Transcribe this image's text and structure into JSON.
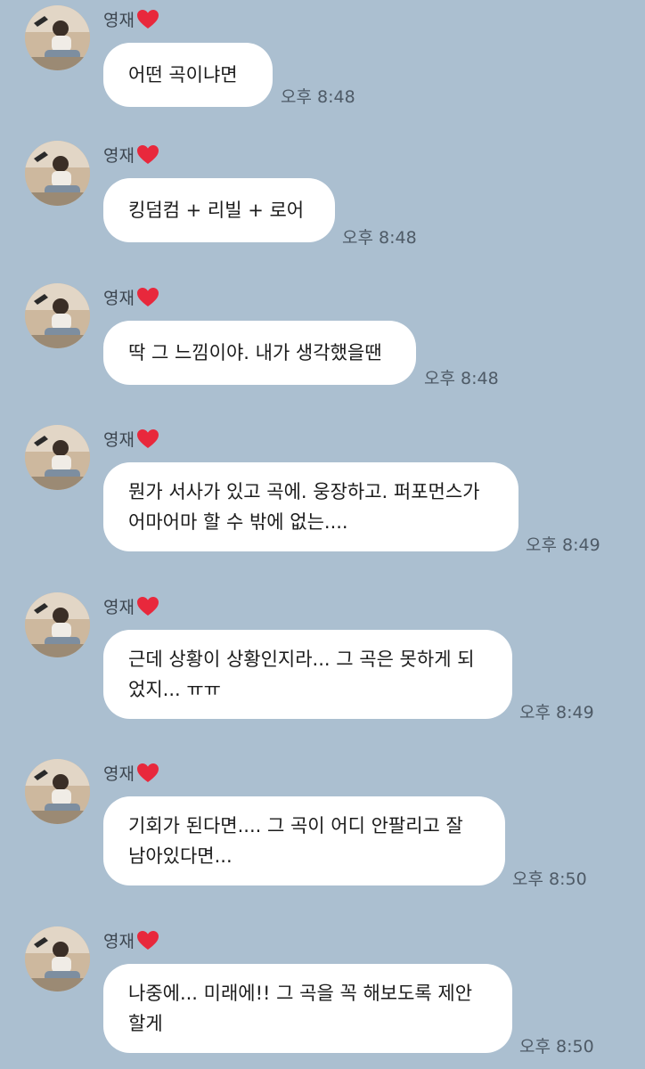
{
  "sender": {
    "name": "영재"
  },
  "colors": {
    "background": "#abbfd0",
    "bubble": "#ffffff",
    "heart": "#e8283c"
  },
  "messages": [
    {
      "text": "어떤 곡이냐면",
      "time": "오후 8:48"
    },
    {
      "text": "킹덤컴 + 리빌 + 로어",
      "time": "오후 8:48"
    },
    {
      "text": "딱 그 느낌이야. 내가 생각했을땐",
      "time": "오후 8:48"
    },
    {
      "text": "뭔가 서사가 있고 곡에. 웅장하고. 퍼포먼스가\n어마어마 할 수 밖에 없는....",
      "time": "오후 8:49"
    },
    {
      "text": "근데 상황이 상황인지라... 그 곡은 못하게 되\n었지... ㅠㅠ",
      "time": "오후 8:49"
    },
    {
      "text": "기회가 된다면.... 그 곡이 어디 안팔리고 잘\n남아있다면...",
      "time": "오후 8:50"
    },
    {
      "text": "나중에... 미래에!! 그 곡을 꼭 해보도록 제안\n할게",
      "time": "오후 8:50"
    }
  ]
}
